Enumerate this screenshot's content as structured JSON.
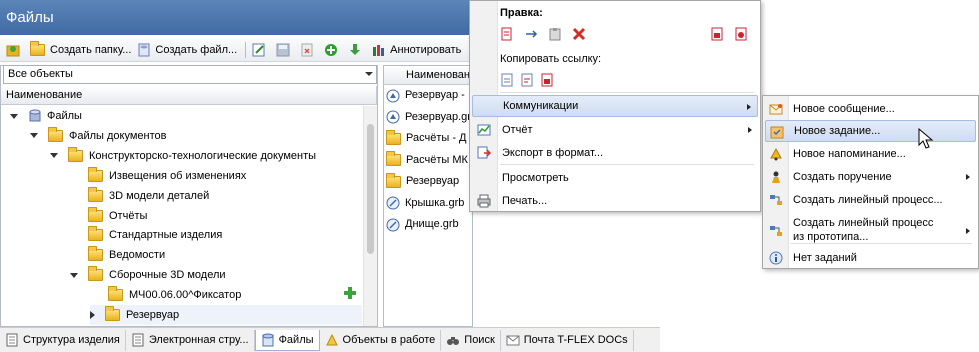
{
  "window": {
    "title": "Файлы"
  },
  "toolbar": {
    "create_folder": "Создать папку...",
    "create_file": "Создать файл...",
    "annotate": "Аннотировать"
  },
  "left_panel": {
    "filter_value": "Все объекты",
    "column_header": "Наименование",
    "tree": [
      {
        "label": "Файлы",
        "icon": "cylinder-icon",
        "state": "expanded"
      },
      {
        "label": "Файлы документов",
        "icon": "folder-icon",
        "state": "expanded"
      },
      {
        "label": "Конструкторско-технологические документы",
        "icon": "folder-icon",
        "state": "expanded"
      },
      {
        "label": "Извещения об изменениях",
        "icon": "folder-icon",
        "state": "leaf"
      },
      {
        "label": "3D модели деталей",
        "icon": "folder-icon",
        "state": "leaf"
      },
      {
        "label": "Отчёты",
        "icon": "folder-icon",
        "state": "leaf"
      },
      {
        "label": "Стандартные изделия",
        "icon": "folder-icon",
        "state": "leaf"
      },
      {
        "label": "Ведомости",
        "icon": "folder-icon",
        "state": "leaf"
      },
      {
        "label": "Сборочные 3D модели",
        "icon": "folder-icon",
        "state": "expanded"
      },
      {
        "label": "МЧ00.06.00^Фиксатор",
        "icon": "folder-icon",
        "state": "leaf"
      },
      {
        "label": "Резервуар",
        "icon": "folder-icon",
        "state": "collapsed"
      }
    ]
  },
  "middle_panel": {
    "column_header": "Наименован",
    "files": [
      {
        "label": "Резервуар -",
        "icon": "assembly-icon"
      },
      {
        "label": "Резервуар.gr",
        "icon": "assembly-icon"
      },
      {
        "label": "Расчёты - Д",
        "icon": "folder-icon"
      },
      {
        "label": "Расчёты МК",
        "icon": "folder-icon"
      },
      {
        "label": "Резервуар",
        "icon": "folder-icon"
      },
      {
        "label": "Крышка.grb",
        "icon": "part-icon"
      },
      {
        "label": "Днище.grb",
        "icon": "part-icon"
      }
    ]
  },
  "bottom_tabs": [
    {
      "label": "Структура изделия",
      "icon": "structure-icon",
      "active": false
    },
    {
      "label": "Электронная стру...",
      "icon": "structure-icon",
      "active": false
    },
    {
      "label": "Файлы",
      "icon": "files-icon",
      "active": true
    },
    {
      "label": "Объекты в работе",
      "icon": "objects-icon",
      "active": false
    },
    {
      "label": "Поиск",
      "icon": "binoculars-icon",
      "active": false
    },
    {
      "label": "Почта T-FLEX DOCs",
      "icon": "mail-icon",
      "active": false
    }
  ],
  "context_menu": {
    "edit_header": "Правка:",
    "copy_link_header": "Копировать ссылку:",
    "items": [
      {
        "label": "Коммуникации",
        "icon": "",
        "submenu": true,
        "highlighted": true
      },
      {
        "label": "Отчёт",
        "icon": "report-icon",
        "submenu": true,
        "highlighted": false
      },
      {
        "label": "Экспорт в формат...",
        "icon": "export-icon",
        "submenu": false,
        "highlighted": false
      },
      {
        "label": "Просмотреть",
        "icon": "",
        "submenu": false,
        "highlighted": false
      },
      {
        "label": "Печать...",
        "icon": "printer-icon",
        "submenu": false,
        "highlighted": false
      }
    ]
  },
  "submenu": {
    "items": [
      {
        "label": "Новое сообщение...",
        "icon": "envelope-icon",
        "submenu": false,
        "highlighted": false
      },
      {
        "label": "Новое задание...",
        "icon": "task-icon",
        "submenu": false,
        "highlighted": true
      },
      {
        "label": "Новое напоминание...",
        "icon": "bell-icon",
        "submenu": false,
        "highlighted": false
      },
      {
        "label": "Создать поручение",
        "icon": "person-icon",
        "submenu": true,
        "highlighted": false
      },
      {
        "label": "Создать линейный процесс...",
        "icon": "process-icon",
        "submenu": false,
        "highlighted": false
      },
      {
        "label": "Создать линейный процесс\nиз прототипа...",
        "icon": "process-icon",
        "submenu": true,
        "highlighted": false
      },
      {
        "label": "Нет заданий",
        "icon": "info-icon",
        "submenu": false,
        "highlighted": false
      }
    ]
  }
}
